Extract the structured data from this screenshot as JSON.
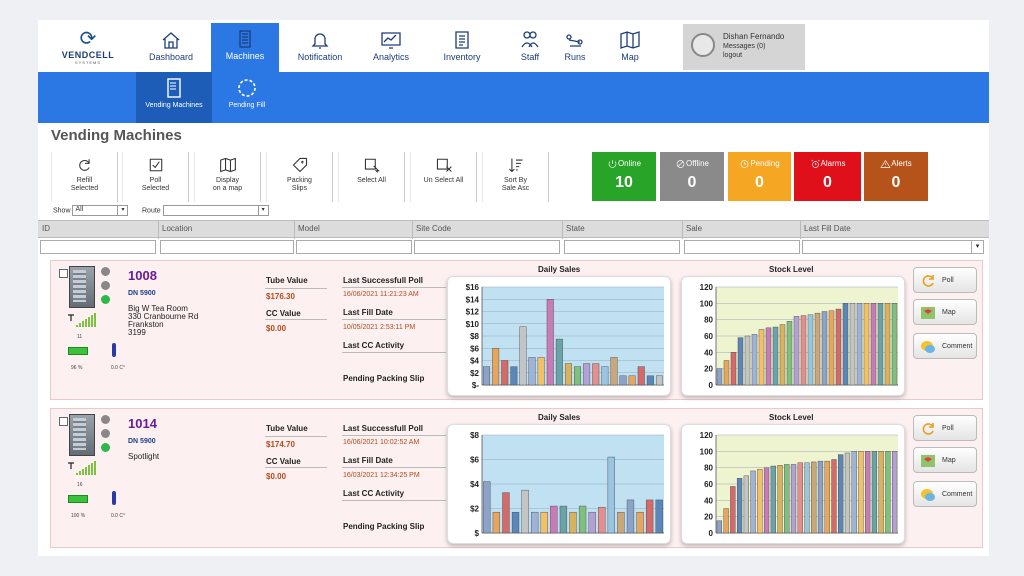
{
  "brand": {
    "name": "VENDCELL",
    "sub": "SYSTEMS"
  },
  "nav": [
    {
      "label": "Dashboard",
      "icon": "home-icon"
    },
    {
      "label": "Machines",
      "icon": "machine-icon",
      "active": true
    },
    {
      "label": "Notification",
      "icon": "bell-icon"
    },
    {
      "label": "Analytics",
      "icon": "analytics-icon"
    },
    {
      "label": "Inventory",
      "icon": "inventory-icon"
    },
    {
      "label": "Staff",
      "icon": "staff-icon"
    },
    {
      "label": "Runs",
      "icon": "runs-icon"
    },
    {
      "label": "Map",
      "icon": "map-icon"
    }
  ],
  "user": {
    "name": "Dishan Fernando",
    "messages": "Messages (0)",
    "logout": "logout"
  },
  "subnav": [
    {
      "label": "Vending Machines",
      "active": true
    },
    {
      "label": "Pending Fill"
    }
  ],
  "page_title": "Vending Machines",
  "toolbar": [
    {
      "label": "Refill\nSelected",
      "icon": "refresh-icon"
    },
    {
      "label": "Poll\nSelected",
      "icon": "check-icon"
    },
    {
      "label": "Display\non a map",
      "icon": "map-icon"
    },
    {
      "label": "Packing\nSlips",
      "icon": "tag-icon"
    },
    {
      "label": "Select All",
      "icon": "select-all-icon"
    },
    {
      "label": "Un Select All",
      "icon": "unselect-all-icon"
    },
    {
      "label": "Sort By\nSale Asc",
      "icon": "sort-icon"
    }
  ],
  "stats": [
    {
      "label": "Online",
      "value": "10",
      "color": "#28a428",
      "icon": "power-icon"
    },
    {
      "label": "Offline",
      "value": "0",
      "color": "#8a8a8a",
      "icon": "block-icon"
    },
    {
      "label": "Pending",
      "value": "0",
      "color": "#f5a623",
      "icon": "clock-icon"
    },
    {
      "label": "Alarms",
      "value": "0",
      "color": "#e0101a",
      "icon": "alarm-icon"
    },
    {
      "label": "Alerts",
      "value": "0",
      "color": "#b5531a",
      "icon": "warning-icon"
    }
  ],
  "filters": {
    "show_label": "Show",
    "show_value": "All",
    "route_label": "Route",
    "route_value": ""
  },
  "columns": [
    "ID",
    "Location",
    "Model",
    "Site Code",
    "State",
    "Sale",
    "Last Fill Date"
  ],
  "labels": {
    "tube": "Tube Value",
    "cc": "CC Value",
    "poll": "Last Successfull Poll",
    "fill": "Last Fill Date",
    "ccact": "Last CC Activity",
    "pack": "Pending Packing Slip",
    "daily": "Daily Sales",
    "stock": "Stock Level"
  },
  "actions": [
    "Poll",
    "Map",
    "Comment"
  ],
  "machines": [
    {
      "id": "1008",
      "model": "DN 5900",
      "address": "Big W Tea Room\n330 Cranbourne Rd\nFrankston\n3199",
      "signal": "11",
      "battery": "96 %",
      "temp": "0.0 C°",
      "tube": "$176.30",
      "cc": "$0.00",
      "poll": "16/06/2021 11:21:23 AM",
      "fill": "10/05/2021 2:53:11 PM"
    },
    {
      "id": "1014",
      "model": "DN 5900",
      "address": "Spotlight",
      "signal": "16",
      "battery": "100 %",
      "temp": "0.0 C°",
      "tube": "$174.70",
      "cc": "$0.00",
      "poll": "16/06/2021 10:02:52 AM",
      "fill": "16/03/2021 12:34:25 PM"
    }
  ],
  "chart_data": [
    {
      "type": "bar",
      "title": "Daily Sales",
      "machine": "1008",
      "ylim": [
        0,
        16
      ],
      "yticks": [
        "$-",
        "$2",
        "$4",
        "$6",
        "$8",
        "$10",
        "$12",
        "$14",
        "$16"
      ],
      "values": [
        3,
        6,
        4,
        3,
        9.5,
        4.5,
        4.5,
        14,
        7.5,
        3.5,
        3,
        3.5,
        3.5,
        3,
        4.5,
        1.5,
        1.5,
        3,
        1.5,
        1.5
      ]
    },
    {
      "type": "bar",
      "title": "Stock Level",
      "machine": "1008",
      "ylim": [
        0,
        120
      ],
      "yticks": [
        "0",
        "20",
        "40",
        "60",
        "80",
        "100",
        "120"
      ],
      "values": [
        20,
        30,
        40,
        58,
        60,
        62,
        68,
        70,
        71,
        74,
        78,
        84,
        85,
        86,
        88,
        90,
        91,
        93,
        100,
        100,
        100,
        100,
        100,
        100,
        100,
        100
      ]
    },
    {
      "type": "bar",
      "title": "Daily Sales",
      "machine": "1014",
      "ylim": [
        0,
        8
      ],
      "yticks": [
        "$",
        "$2",
        "$4",
        "$6",
        "$8"
      ],
      "values": [
        4.2,
        1.7,
        3.3,
        1.7,
        3.5,
        1.7,
        1.7,
        2.2,
        2.2,
        1.7,
        2.2,
        1.7,
        2.1,
        6.2,
        1.7,
        2.7,
        1.7,
        2.7,
        2.7
      ]
    },
    {
      "type": "bar",
      "title": "Stock Level",
      "machine": "1014",
      "ylim": [
        0,
        120
      ],
      "yticks": [
        "0",
        "20",
        "40",
        "60",
        "80",
        "100",
        "120"
      ],
      "values": [
        15,
        30,
        57,
        67,
        70,
        76,
        78,
        80,
        82,
        83,
        84,
        84,
        86,
        86,
        87,
        88,
        88,
        90,
        96,
        98,
        100,
        100,
        100,
        100,
        100,
        100,
        100
      ]
    }
  ]
}
